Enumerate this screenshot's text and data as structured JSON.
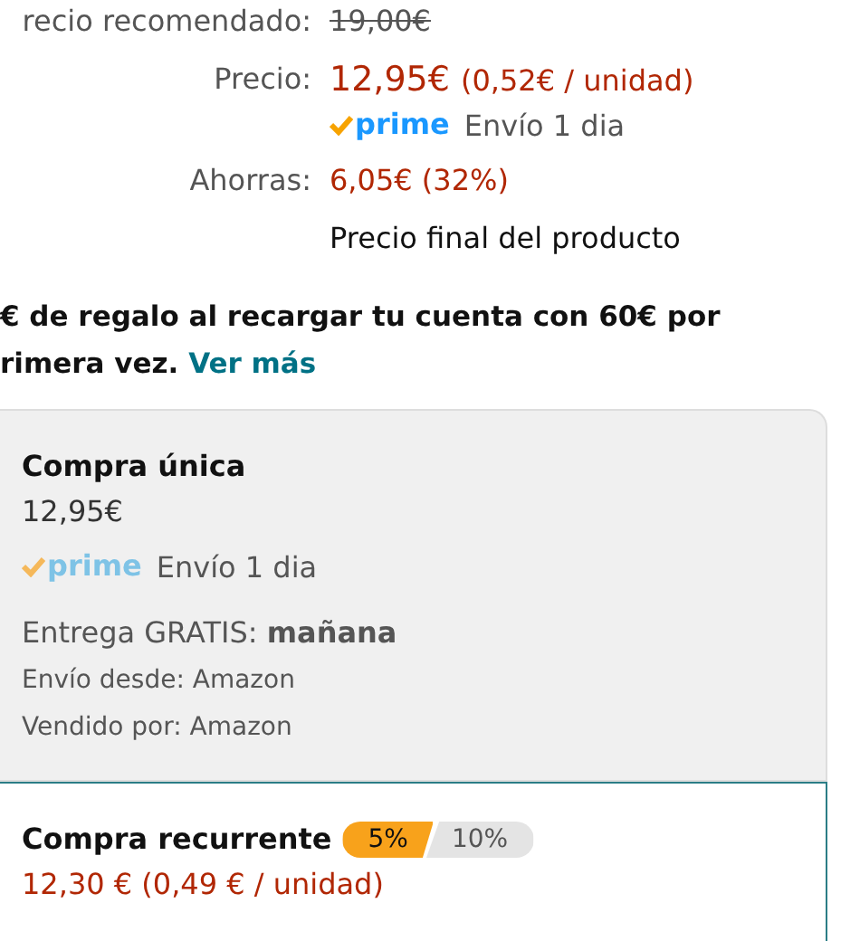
{
  "price_rows": [
    {
      "kind": "strike",
      "label": "recio recomendado:",
      "value": "19,00€"
    },
    {
      "kind": "price",
      "label": "Precio:",
      "value": "12,95€",
      "unit": "(0,52€ / unidad)",
      "prime": "prime",
      "shipping": "Envío 1 dia"
    },
    {
      "kind": "savings",
      "label": "Ahorras:",
      "value": "6,05€ (32%)"
    },
    {
      "kind": "note",
      "value": "Precio final del producto"
    }
  ],
  "promo": {
    "lines": [
      "€ de regalo al recargar tu cuenta con 60€ por",
      "rimera vez."
    ],
    "link": "Ver más"
  },
  "options": [
    {
      "title": "Compra única",
      "selected": false,
      "price": "12,95€",
      "prime": "prime",
      "shipping": "Envío 1 dia",
      "delivery_label": "Entrega GRATIS:",
      "delivery_day": "mañana",
      "ships_from": "Envío desde: Amazon",
      "sold_by": "Vendido por: Amazon"
    },
    {
      "title": "Compra recurrente",
      "selected": true,
      "tiers": [
        {
          "label": "5%",
          "selected": true
        },
        {
          "label": "10%",
          "selected": false
        }
      ],
      "price": "12,30 € (0,49 € / unidad)"
    }
  ]
}
